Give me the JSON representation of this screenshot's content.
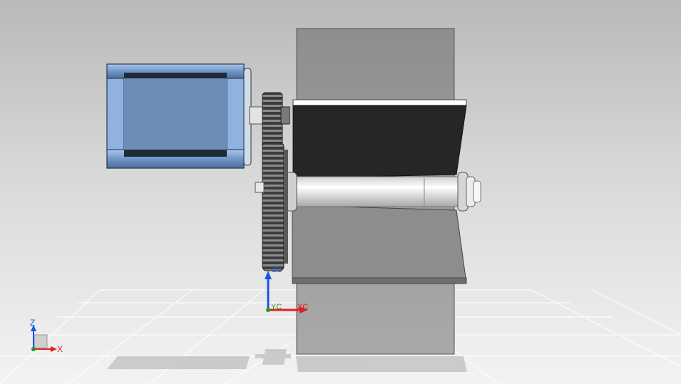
{
  "viewport": {
    "background_top": "#b9b9b9",
    "background_bottom": "#f3f3f3"
  },
  "datum_csys": {
    "x_label": "XC",
    "y_label": "YC",
    "z_label": "ZC",
    "x_color": "#e02020",
    "y_color": "#20a020",
    "z_color": "#1a55e0"
  },
  "view_triad": {
    "x_label": "X",
    "z_label": "Z",
    "x_color": "#e02020",
    "z_color": "#1a55e0"
  },
  "model": {
    "motor_color": "#7ea6d8",
    "gear_color": "#3a3a3a",
    "shaft_color": "#f2f2f2",
    "plate_color": "#2a2a2a",
    "pillar_color": "#9c9c9c"
  }
}
